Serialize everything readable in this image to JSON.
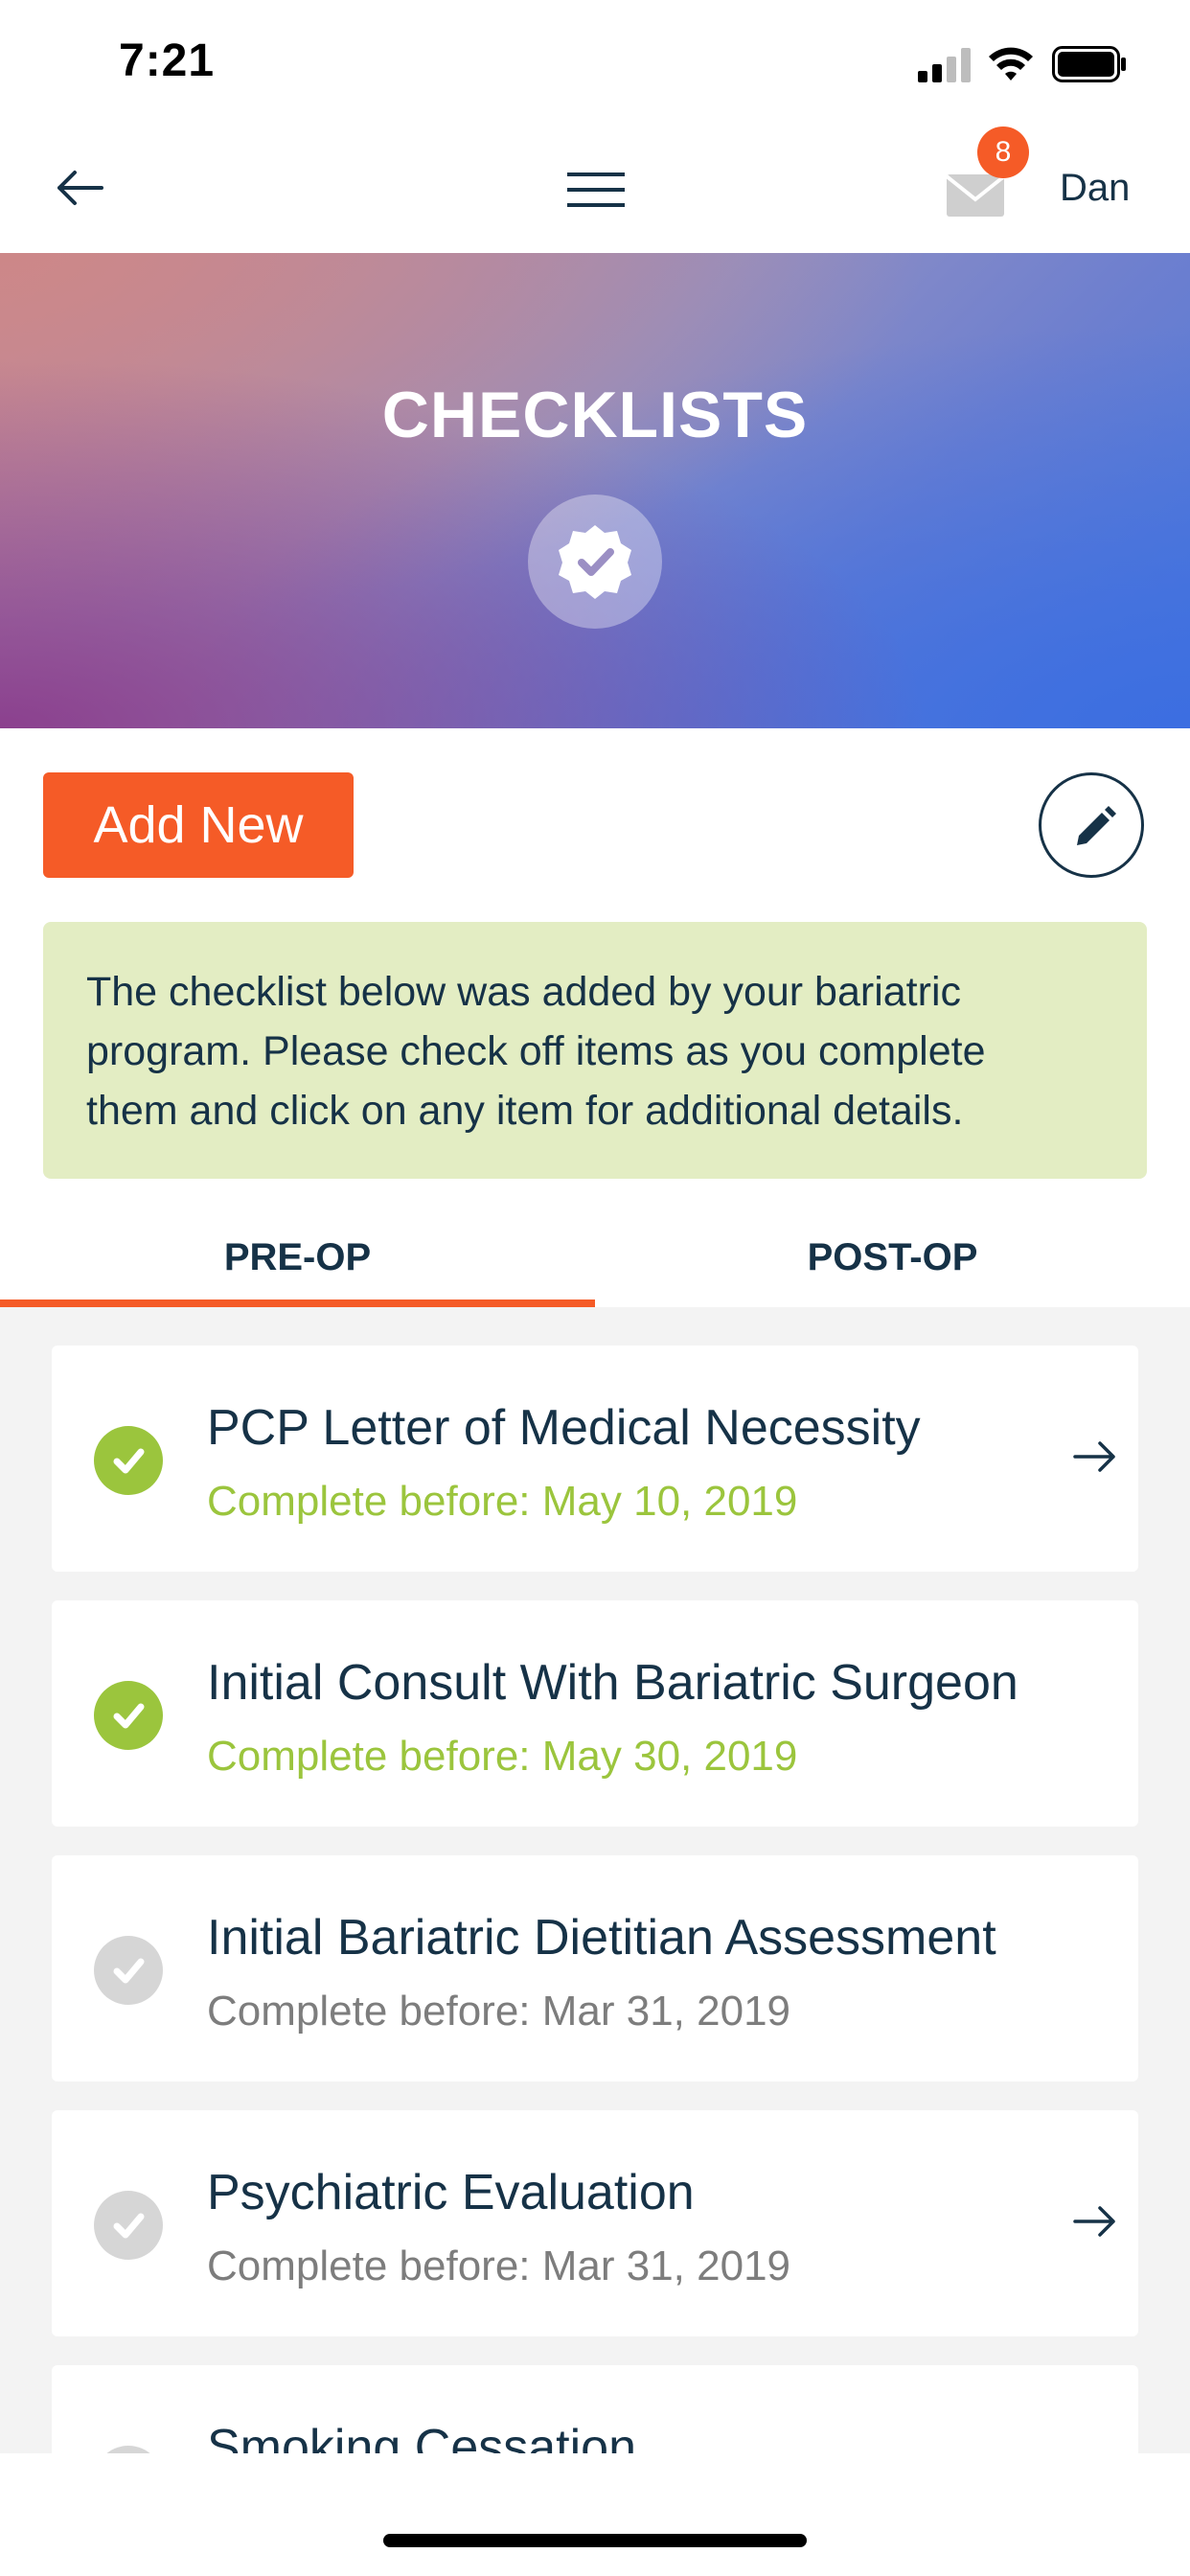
{
  "status_bar": {
    "time": "7:21"
  },
  "nav": {
    "mail_badge_count": "8",
    "user_name": "Dan"
  },
  "hero": {
    "title": "CHECKLISTS"
  },
  "actions": {
    "add_new_label": "Add New"
  },
  "info": {
    "lines": [
      "The checklist below was added by your bariatric",
      "program. Please check off items as you complete",
      "them and click on any item for additional details."
    ]
  },
  "tabs": [
    {
      "label": "PRE-OP",
      "active": true
    },
    {
      "label": "POST-OP",
      "active": false
    }
  ],
  "checklist": [
    {
      "title": "PCP Letter of Medical Necessity",
      "subtitle": "Complete before: May 10, 2019",
      "completed": true,
      "has_arrow": true
    },
    {
      "title": "Initial Consult With Bariatric Surgeon",
      "subtitle": "Complete before: May 30, 2019",
      "completed": true,
      "has_arrow": false
    },
    {
      "title": "Initial Bariatric Dietitian Assessment",
      "subtitle": "Complete before: Mar 31, 2019",
      "completed": false,
      "has_arrow": false
    },
    {
      "title": "Psychiatric Evaluation",
      "subtitle": "Complete before: Mar 31, 2019",
      "completed": false,
      "has_arrow": true
    },
    {
      "title": "Smoking Cessation",
      "subtitle": "",
      "completed": false,
      "has_arrow": false
    }
  ],
  "colors": {
    "accent": "#f55b27",
    "complete_green": "#9bc53d",
    "incomplete_gray": "#d6d6d6",
    "text_dark": "#163247",
    "subtext_gray": "#7d7d7d",
    "info_bg": "#e3edc3"
  },
  "icons": {
    "back": "arrow-left-icon",
    "menu": "hamburger-menu-icon",
    "mail": "envelope-icon",
    "hero": "verified-check-badge-icon",
    "edit": "pencil-icon",
    "item_check": "check-circle-icon",
    "item_arrow": "arrow-right-icon"
  }
}
